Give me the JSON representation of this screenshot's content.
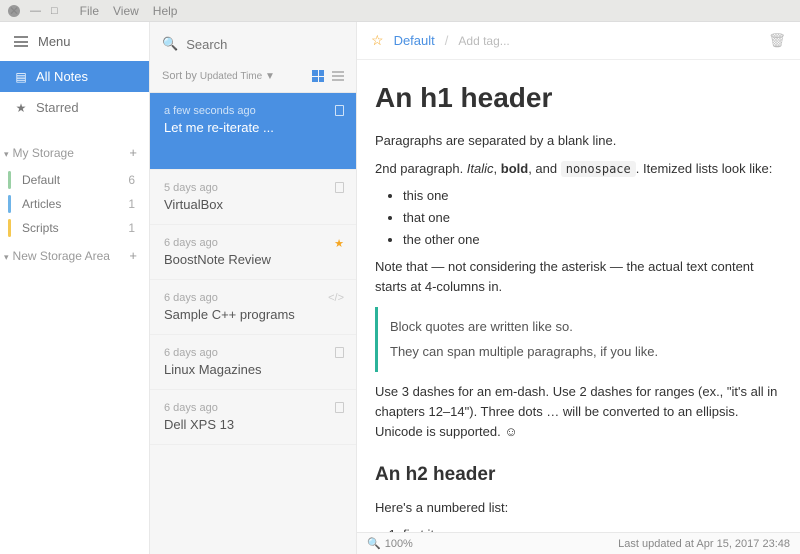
{
  "titlebar": {
    "menus": [
      "File",
      "View",
      "Help"
    ]
  },
  "sidebar": {
    "menu_label": "Menu",
    "allnotes": "All Notes",
    "starred": "Starred",
    "sections": [
      {
        "label": "My Storage",
        "items": [
          {
            "label": "Default",
            "count": "6",
            "color": "#9ad0a5"
          },
          {
            "label": "Articles",
            "count": "1",
            "color": "#6fb4e8"
          },
          {
            "label": "Scripts",
            "count": "1",
            "color": "#f5c851"
          }
        ]
      },
      {
        "label": "New Storage Area",
        "items": []
      }
    ]
  },
  "notelist": {
    "search_placeholder": "Search",
    "sort_label": "Sort by",
    "sort_value": "Updated Time ▼",
    "notes": [
      {
        "time": "a few seconds ago",
        "title": "Let me re-iterate ...",
        "selected": true,
        "type": "doc"
      },
      {
        "time": "5 days ago",
        "title": "VirtualBox",
        "type": "doc"
      },
      {
        "time": "6 days ago",
        "title": "BoostNote Review",
        "starred": true,
        "type": "doc"
      },
      {
        "time": "6 days ago",
        "title": "Sample C++ programs",
        "type": "code"
      },
      {
        "time": "6 days ago",
        "title": "Linux Magazines",
        "type": "doc"
      },
      {
        "time": "6 days ago",
        "title": "Dell XPS 13",
        "type": "doc"
      }
    ]
  },
  "content": {
    "breadcrumb": "Default",
    "tag_placeholder": "Add tag...",
    "h1": "An h1 header",
    "p1": "Paragraphs are separated by a blank line.",
    "p2a": "2nd paragraph. ",
    "italic": "Italic",
    "bold": "bold",
    "mono": "nonospace",
    "p2b": ". Itemized lists look like:",
    "ul": [
      "this one",
      "that one",
      "the other one"
    ],
    "p3": "Note that — not considering the asterisk — the actual text content starts at 4-columns in.",
    "bq1": "Block quotes are written like so.",
    "bq2": "They can span multiple paragraphs, if you like.",
    "p4": "Use 3 dashes for an em-dash. Use 2 dashes for ranges (ex., \"it's all in chapters 12–14\"). Three dots … will be converted to an ellipsis. Unicode is supported. ☺",
    "h2": "An h2 header",
    "p5": "Here's a numbered list:",
    "ol": [
      "first item"
    ]
  },
  "status": {
    "zoom": "100%",
    "updated": "Last updated at Apr 15, 2017 23:48"
  }
}
